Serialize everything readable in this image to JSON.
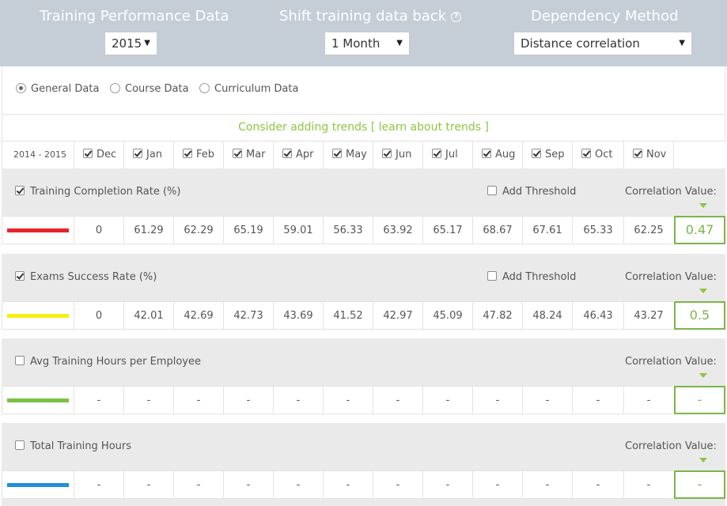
{
  "header": {
    "performance": {
      "title": "Training Performance Data",
      "selected": "2015"
    },
    "shift": {
      "title": "Shift training data back",
      "help_icon": "question-circle-icon",
      "selected": "1 Month"
    },
    "dependency": {
      "title": "Dependency Method",
      "selected": "Distance correlation"
    }
  },
  "data_type": {
    "options": [
      {
        "label": "General Data",
        "selected": true
      },
      {
        "label": "Course Data",
        "selected": false
      },
      {
        "label": "Curriculum Data",
        "selected": false
      }
    ]
  },
  "trend_hint": {
    "prefix": "Consider adding trends ",
    "link": "[ learn about trends ]"
  },
  "months_header": {
    "period": "2014 - 2015",
    "months": [
      "Dec",
      "Jan",
      "Feb",
      "Mar",
      "Apr",
      "May",
      "Jun",
      "Jul",
      "Aug",
      "Sep",
      "Oct",
      "Nov"
    ]
  },
  "metrics": [
    {
      "label": "Training Completion Rate (%)",
      "checked": true,
      "threshold_label": "Add Threshold",
      "show_threshold": true,
      "correlation_label": "Correlation Value:",
      "color": "#e8232a",
      "values": [
        "0",
        "61.29",
        "62.29",
        "65.19",
        "59.01",
        "56.33",
        "63.92",
        "65.17",
        "68.67",
        "67.61",
        "65.33",
        "62.25"
      ],
      "correlation": "0.47"
    },
    {
      "label": "Exams Success Rate (%)",
      "checked": true,
      "threshold_label": "Add Threshold",
      "show_threshold": true,
      "correlation_label": "Correlation Value:",
      "color": "#f5ef14",
      "values": [
        "0",
        "42.01",
        "42.69",
        "42.73",
        "43.69",
        "41.52",
        "42.97",
        "45.09",
        "47.82",
        "48.24",
        "46.43",
        "43.27"
      ],
      "correlation": "0.5"
    },
    {
      "label": "Avg Training Hours per Employee",
      "checked": false,
      "show_threshold": false,
      "correlation_label": "Correlation Value:",
      "color": "#7ac143",
      "values": [
        "-",
        "-",
        "-",
        "-",
        "-",
        "-",
        "-",
        "-",
        "-",
        "-",
        "-",
        "-"
      ],
      "correlation": "-"
    },
    {
      "label": "Total Training Hours",
      "checked": false,
      "show_threshold": false,
      "correlation_label": "Correlation Value:",
      "color": "#1e90d8",
      "values": [
        "-",
        "-",
        "-",
        "-",
        "-",
        "-",
        "-",
        "-",
        "-",
        "-",
        "-",
        "-"
      ],
      "correlation": "-"
    }
  ]
}
